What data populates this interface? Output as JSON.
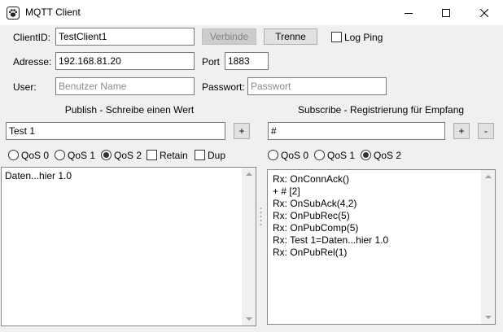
{
  "window": {
    "title": "MQTT Client"
  },
  "connection": {
    "clientid_label": "ClientID:",
    "clientid_value": "TestClient1",
    "connect_label": "Verbinde",
    "disconnect_label": "Trenne",
    "logping_label": "Log Ping",
    "address_label": "Adresse:",
    "address_value": "192.168.81.20",
    "port_label": "Port",
    "port_value": "1883",
    "user_label": "User:",
    "user_placeholder": "Benutzer Name",
    "password_label": "Passwort:",
    "password_placeholder": "Passwort"
  },
  "publish": {
    "header": "Publish - Schreibe einen Wert",
    "topic_value": "Test 1",
    "add_label": "+",
    "qos0": "QoS 0",
    "qos1": "QoS 1",
    "qos2": "QoS 2",
    "retain_label": "Retain",
    "dup_label": "Dup",
    "message": "Daten...hier 1.0"
  },
  "subscribe": {
    "header": "Subscribe - Registrierung für Empfang",
    "topic_value": "#",
    "add_label": "+",
    "remove_label": "-",
    "qos0": "QoS 0",
    "qos1": "QoS 1",
    "qos2": "QoS 2",
    "log": [
      "Rx: OnConnAck()",
      "+ # [2]",
      "Rx: OnSubAck(4,2)",
      "Rx: OnPubRec(5)",
      "Rx: OnPubComp(5)",
      "Rx: Test 1=Daten...hier 1.0",
      "Rx: OnPubRel(1)"
    ]
  }
}
